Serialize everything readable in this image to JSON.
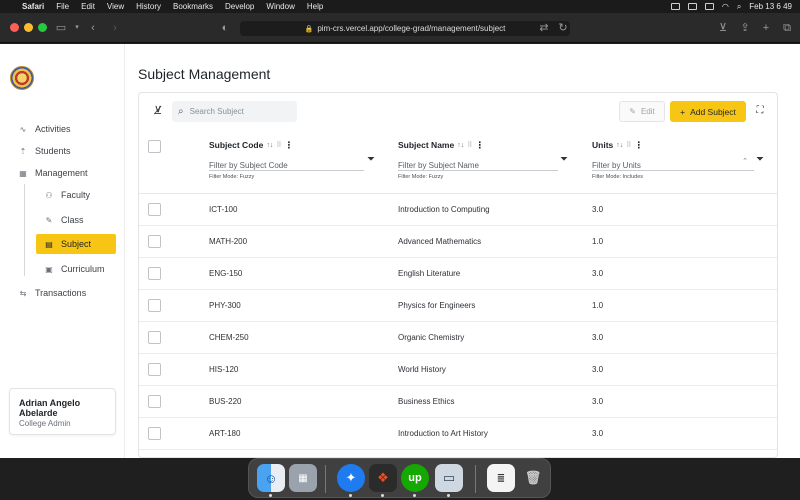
{
  "menubar": {
    "app": "Safari",
    "items": [
      "File",
      "Edit",
      "View",
      "History",
      "Bookmarks",
      "Develop",
      "Window",
      "Help"
    ],
    "clock": "Feb 13  6 49"
  },
  "browser": {
    "url": "pim-crs.vercel.app/college-grad/management/subject",
    "traffic_colors": [
      "#ff5f57",
      "#febc2e",
      "#28c840"
    ]
  },
  "sidebar": {
    "items": [
      {
        "label": "Activities",
        "icon": "activity-icon"
      },
      {
        "label": "Students",
        "icon": "students-icon"
      },
      {
        "label": "Management",
        "icon": "calendar-icon"
      }
    ],
    "sub_items": [
      {
        "label": "Faculty",
        "icon": "person-icon"
      },
      {
        "label": "Class",
        "icon": "pencil-icon"
      },
      {
        "label": "Subject",
        "icon": "book-icon",
        "active": true
      },
      {
        "label": "Curriculum",
        "icon": "document-icon"
      }
    ],
    "transactions": {
      "label": "Transactions",
      "icon": "transfer-icon"
    },
    "user": {
      "name": "Adrian Angelo Abelarde",
      "role": "College Admin"
    }
  },
  "main": {
    "title": "Subject Management",
    "search_placeholder": "Search Subject",
    "edit_label": "Edit",
    "add_label": "Add Subject",
    "columns": [
      {
        "title": "Subject Code",
        "filter_placeholder": "Filter by Subject Code",
        "filter_mode": "Filter Mode: Fuzzy"
      },
      {
        "title": "Subject Name",
        "filter_placeholder": "Filter by Subject Name",
        "filter_mode": "Filter Mode: Fuzzy"
      },
      {
        "title": "Units",
        "filter_placeholder": "Filter by Units",
        "filter_mode": "Filter Mode: Includes"
      }
    ],
    "rows": [
      {
        "code": "ICT-100",
        "name": "Introduction to Computing",
        "units": "3.0"
      },
      {
        "code": "MATH-200",
        "name": "Advanced Mathematics",
        "units": "1.0"
      },
      {
        "code": "ENG-150",
        "name": "English Literature",
        "units": "3.0"
      },
      {
        "code": "PHY-300",
        "name": "Physics for Engineers",
        "units": "1.0"
      },
      {
        "code": "CHEM-250",
        "name": "Organic Chemistry",
        "units": "3.0"
      },
      {
        "code": "HIS-120",
        "name": "World History",
        "units": "3.0"
      },
      {
        "code": "BUS-220",
        "name": "Business Ethics",
        "units": "3.0"
      },
      {
        "code": "ART-180",
        "name": "Introduction to Art History",
        "units": "3.0"
      }
    ]
  },
  "colors": {
    "accent": "#f7c513"
  },
  "dock": [
    "finder-icon",
    "launchpad-icon",
    "safari-icon",
    "figma-icon",
    "upwork-icon",
    "preview-icon",
    "document-icon",
    "trash-icon"
  ]
}
